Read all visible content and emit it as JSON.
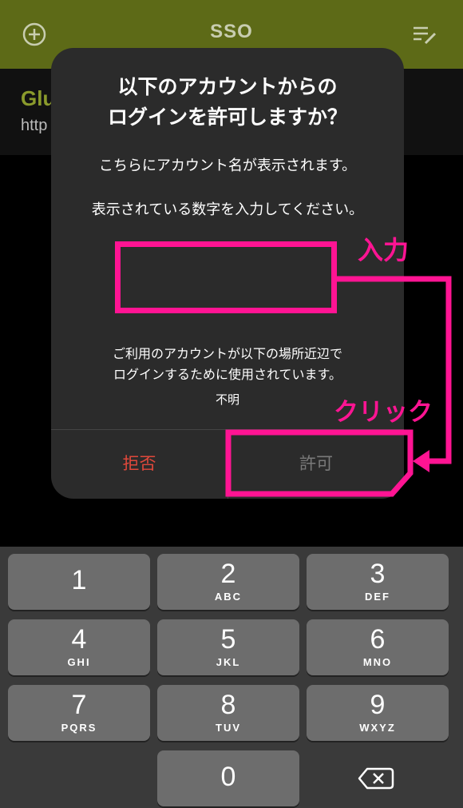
{
  "topbar": {
    "title": "SSO",
    "add_icon": "plus-circle-icon",
    "edit_icon": "list-edit-icon"
  },
  "background_row": {
    "name": "Glu",
    "url": "http"
  },
  "dialog": {
    "title_line1": "以下のアカウントからの",
    "title_line2": "ログインを許可しますか？",
    "account_text": "こちらにアカウント名が表示されます。",
    "prompt": "表示されている数字を入力してください。",
    "code_input_value": "",
    "location_note_line1": "ご利用のアカウントが以下の場所近辺で",
    "location_note_line2": "ログインするために使用されています。",
    "location": "不明",
    "deny_label": "拒否",
    "allow_label": "許可"
  },
  "annotations": {
    "input_label": "入力",
    "click_label": "クリック",
    "color": "#ff1493"
  },
  "keypad": {
    "keys": [
      {
        "num": "1",
        "letters": ""
      },
      {
        "num": "2",
        "letters": "ABC"
      },
      {
        "num": "3",
        "letters": "DEF"
      },
      {
        "num": "4",
        "letters": "GHI"
      },
      {
        "num": "5",
        "letters": "JKL"
      },
      {
        "num": "6",
        "letters": "MNO"
      },
      {
        "num": "7",
        "letters": "PQRS"
      },
      {
        "num": "8",
        "letters": "TUV"
      },
      {
        "num": "9",
        "letters": "WXYZ"
      },
      {
        "num": "0",
        "letters": ""
      }
    ],
    "backspace_icon": "backspace-icon"
  },
  "colors": {
    "topbar": "#5d6a17",
    "deny": "#e0483b",
    "accent_annotation": "#ff1493"
  }
}
